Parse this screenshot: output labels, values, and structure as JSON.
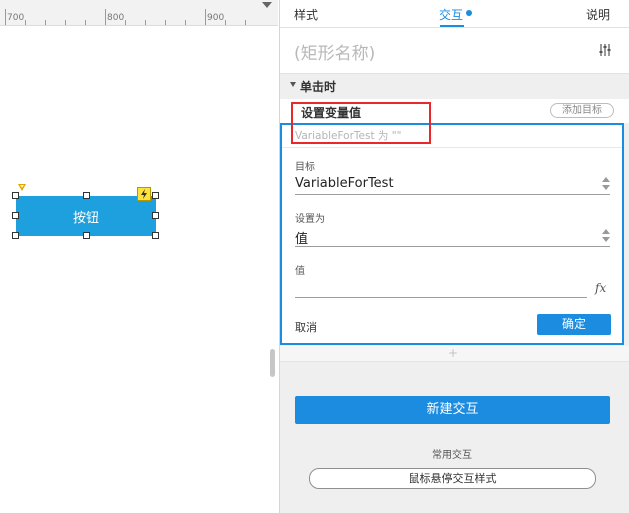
{
  "ruler": {
    "labels": [
      "700",
      "800",
      "900"
    ]
  },
  "canvas": {
    "widget_label": "按钮"
  },
  "panel": {
    "tabs": {
      "style": "样式",
      "interactions": "交互",
      "notes": "说明"
    },
    "shape_name_placeholder": "(矩形名称)",
    "event_title": "单击时",
    "action": {
      "title": "设置变量值",
      "add_target": "添加目标",
      "summary": "VariableForTest 为 \"\"",
      "target_label": "目标",
      "target_value": "VariableForTest",
      "set_to_label": "设置为",
      "set_to_value": "值",
      "value_label": "值",
      "value_value": "",
      "fx": "fx",
      "cancel": "取消",
      "ok": "确定"
    },
    "add_symbol": "+",
    "new_interaction": "新建交互",
    "common_label": "常用交互",
    "hover_style": "鼠标悬停交互样式"
  },
  "colors": {
    "accent": "#1b8ce0",
    "widget": "#1fa0de",
    "highlight": "#e8282b"
  },
  "icons": [
    "settings-sliders-icon",
    "lightning-icon",
    "chevron-down-icon",
    "spinner-icon",
    "fx-icon"
  ]
}
